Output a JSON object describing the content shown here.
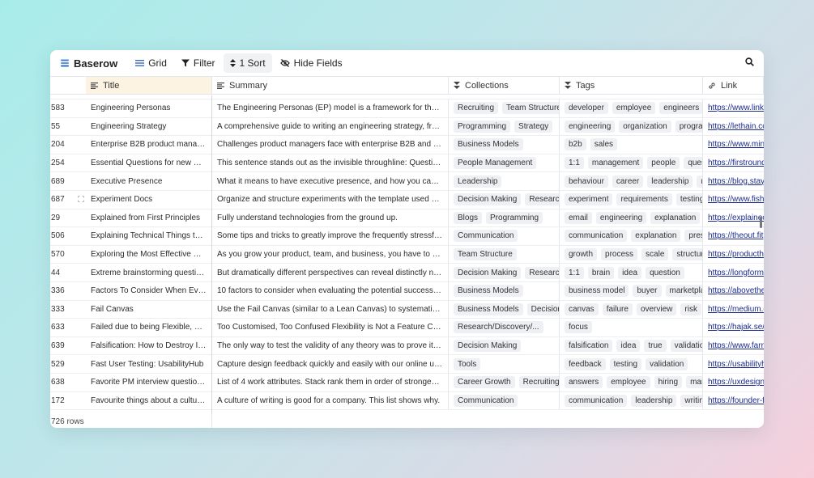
{
  "app": {
    "name": "Baserow"
  },
  "toolbar": {
    "grid": "Grid",
    "filter": "Filter",
    "sort": "1 Sort",
    "hide_fields": "Hide Fields"
  },
  "columns": {
    "title": "Title",
    "summary": "Summary",
    "collections": "Collections",
    "tags": "Tags",
    "link": "Link"
  },
  "rows": [
    {
      "id": "583",
      "title": "Engineering Personas",
      "summary": "The Engineering Personas (EP) model is a framework for the type ...",
      "collections": [
        "Recruiting",
        "Team Structure"
      ],
      "tags": [
        "developer",
        "employee",
        "engineers",
        "hi"
      ],
      "link": "https://www.linke"
    },
    {
      "id": "55",
      "title": "Engineering Strategy",
      "summary": "A comprehensive guide to writing an engineering strategy, from t...",
      "collections": [
        "Programming",
        "Strategy"
      ],
      "tags": [
        "engineering",
        "organization",
        "programm"
      ],
      "link": "https://lethain.co"
    },
    {
      "id": "204",
      "title": "Enterprise B2B product manage...",
      "summary": "Challenges product managers face with enterprise B2B and soluti...",
      "collections": [
        "Business Models"
      ],
      "tags": [
        "b2b",
        "sales"
      ],
      "link": "https://www.min"
    },
    {
      "id": "254",
      "title": "Essential Questions for new Ma...",
      "summary": "This sentence stands out as the invisible throughline: Questions a...",
      "collections": [
        "People Management"
      ],
      "tags": [
        "1:1",
        "management",
        "people",
        "question"
      ],
      "link": "https://firstround"
    },
    {
      "id": "689",
      "title": "Executive Presence",
      "summary": "What it means to have executive presence, and how you can buil...",
      "collections": [
        "Leadership"
      ],
      "tags": [
        "behaviour",
        "career",
        "leadership",
        "man"
      ],
      "link": "https://blog.stays"
    },
    {
      "id": "687",
      "title": "Experiment Docs",
      "summary": "Organize and structure experiments with the template used at ov...",
      "collections": [
        "Decision Making",
        "Research/D"
      ],
      "tags": [
        "experiment",
        "requirements",
        "testing"
      ],
      "link": "https://www.fish"
    },
    {
      "id": "29",
      "title": "Explained from First Principles",
      "summary": "Fully understand technologies from the ground up.",
      "collections": [
        "Blogs",
        "Programming"
      ],
      "tags": [
        "email",
        "engineering",
        "explanation",
        "gu"
      ],
      "link": "https://explainec"
    },
    {
      "id": "506",
      "title": "Explaining Technical Things to N...",
      "summary": "Some tips and tricks to greatly improve the frequently stressful, e...",
      "collections": [
        "Communication"
      ],
      "tags": [
        "communication",
        "explanation",
        "presen"
      ],
      "link": "https://theout.fit"
    },
    {
      "id": "570",
      "title": "Exploring the Most Effective Pro...",
      "summary": "As you grow your product, team, and business, you have to evolv...",
      "collections": [
        "Team Structure"
      ],
      "tags": [
        "growth",
        "process",
        "scale",
        "structure"
      ],
      "link": "https://producth"
    },
    {
      "id": "44",
      "title": "Extreme brainstorming question...",
      "summary": "But dramatically different perspectives can reveal distinctly new i...",
      "collections": [
        "Decision Making",
        "Research/D"
      ],
      "tags": [
        "1:1",
        "brain",
        "idea",
        "question"
      ],
      "link": "https://longform"
    },
    {
      "id": "336",
      "title": "Factors To Consider When Evalu...",
      "summary": "10 factors to consider when evaluating the potential success of a ...",
      "collections": [
        "Business Models"
      ],
      "tags": [
        "business model",
        "buyer",
        "marketplace"
      ],
      "link": "https://abovethe"
    },
    {
      "id": "333",
      "title": "Fail Canvas",
      "summary": "Use the Fail Canvas (similar to a Lean Canvas) to systematically as...",
      "collections": [
        "Business Models",
        "Decision M"
      ],
      "tags": [
        "canvas",
        "failure",
        "overview",
        "risk"
      ],
      "link": "https://medium.c"
    },
    {
      "id": "633",
      "title": "Failed due to being Flexible, not ...",
      "summary": "Too Customised, Too Confused Flexibility is Not a Feature Carrots...",
      "collections": [
        "Research/Discovery/..."
      ],
      "tags": [
        "focus"
      ],
      "link": "https://hajak.se/l"
    },
    {
      "id": "639",
      "title": "Falsification: How to Destroy Inc...",
      "summary": "The only way to test the validity of any theory was to prove it wro...",
      "collections": [
        "Decision Making"
      ],
      "tags": [
        "falsification",
        "idea",
        "true",
        "validation"
      ],
      "link": "https://www.farn"
    },
    {
      "id": "529",
      "title": "Fast User Testing: UsabilityHub",
      "summary": "Capture design feedback quickly and easily with our online usabili...",
      "collections": [
        "Tools"
      ],
      "tags": [
        "feedback",
        "testing",
        "validation"
      ],
      "link": "https://usabilityh"
    },
    {
      "id": "638",
      "title": "Favorite PM interview question f...",
      "summary": "List of 4 work attributes. Stack rank them in order of strongest to ...",
      "collections": [
        "Career Growth",
        "Recruiting"
      ],
      "tags": [
        "answers",
        "employee",
        "hiring",
        "manag"
      ],
      "link": "https://uxdesign."
    },
    {
      "id": "172",
      "title": "Favourite things about a culture ...",
      "summary": "A culture of writing is good for a company. This list shows why.",
      "collections": [
        "Communication"
      ],
      "tags": [
        "communication",
        "leadership",
        "writing"
      ],
      "link": "https://founder-f"
    }
  ],
  "footer": {
    "row_count": "726 rows"
  }
}
